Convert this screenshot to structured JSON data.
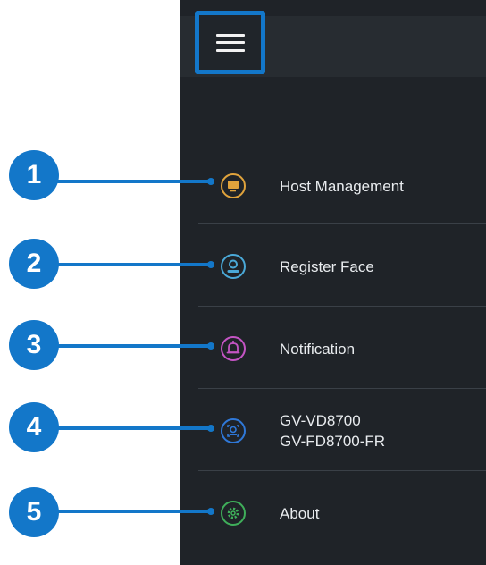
{
  "menu_items": [
    {
      "label": "Host Management",
      "icon": "monitor-icon",
      "color": "#e0a33c"
    },
    {
      "label": "Register Face",
      "icon": "person-face-icon",
      "color": "#4aa9d8"
    },
    {
      "label": "Notification",
      "icon": "bell-icon",
      "color": "#c454c4"
    },
    {
      "label_lines": [
        "GV-VD8700",
        "GV-FD8700-FR"
      ],
      "icon": "device-camera-icon",
      "color": "#2f78d8"
    },
    {
      "label": "About",
      "icon": "gear-icon",
      "color": "#3fae5a"
    }
  ],
  "callouts": [
    "1",
    "2",
    "3",
    "4",
    "5"
  ],
  "colors": {
    "drawer_bg": "#1f2328",
    "header_bg": "#272c31",
    "callout": "#1377c9",
    "text": "#e9ecef"
  }
}
